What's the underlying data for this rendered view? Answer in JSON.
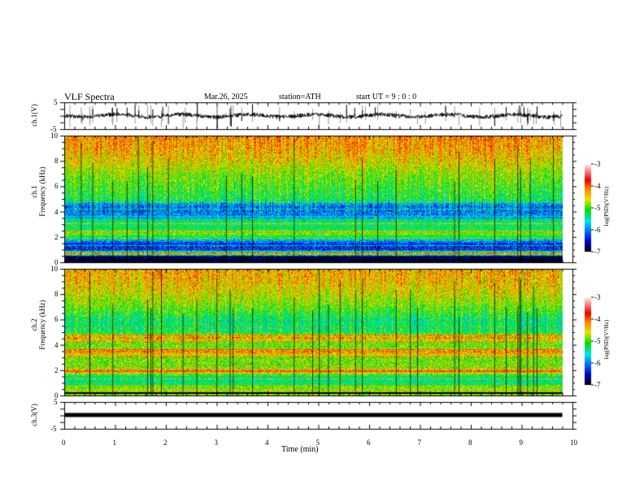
{
  "header": {
    "title": "VLF  Spectra",
    "date": "Mar.26, 2025",
    "station": "station=ATH",
    "start": "start  UT  =   9  : 0  : 0"
  },
  "chart_data": [
    {
      "type": "line",
      "name_label": "ch.1(V)",
      "ylabel": "ch.1(V)",
      "ylim": [
        -5,
        5
      ],
      "yticks": [
        "5",
        "-5"
      ],
      "xlim": [
        0,
        10
      ],
      "data_end_min": 9.8,
      "baseline_v": 0
    },
    {
      "type": "heatmap",
      "ylabel": "ch.1\nFrequency  (kHz)",
      "ylabel_top": "ch.1",
      "ylabel_bottom": "Frequency  (kHz)",
      "ylim": [
        0,
        10
      ],
      "yticks": [
        "0",
        "2",
        "4",
        "6",
        "8",
        "10"
      ],
      "xlim": [
        0,
        10
      ],
      "colorbar": {
        "label": "log(PSD)(V²/Hz)",
        "range": [
          -7,
          -3
        ],
        "ticks": [
          "-3",
          "-4",
          "-5",
          "-6",
          "-7"
        ]
      },
      "profile_khz": [
        0,
        0.5,
        0.7,
        1,
        1.5,
        2,
        2.3,
        2.7,
        3.2,
        3.6,
        4,
        4.5,
        5,
        6,
        7,
        8,
        9,
        10
      ],
      "profile_log_psd": [
        -6.9,
        -6.8,
        -4.2,
        -6.3,
        -6.3,
        -5.3,
        -4.8,
        -5.3,
        -5.2,
        -5.9,
        -6.0,
        -6.0,
        -5.2,
        -5.0,
        -4.8,
        -4.5,
        -4.3,
        -4.2
      ]
    },
    {
      "type": "heatmap",
      "ylabel_top": "ch.2",
      "ylabel_bottom": "Frequency  (kHz)",
      "ylim": [
        0,
        10
      ],
      "yticks": [
        "0",
        "2",
        "4",
        "6",
        "8",
        "10"
      ],
      "xlim": [
        0,
        10
      ],
      "colorbar": {
        "label": "log(PSD)(V²/Hz)",
        "range": [
          -7,
          -3
        ],
        "ticks": [
          "-3",
          "-4",
          "-5",
          "-6",
          "-7"
        ]
      },
      "profile_khz": [
        0,
        0.5,
        1,
        1.5,
        2,
        2.2,
        3,
        3.5,
        3.8,
        4.2,
        4.6,
        5,
        6,
        7,
        8,
        9,
        10
      ],
      "profile_log_psd": [
        -4.8,
        -4.7,
        -5.3,
        -5.4,
        -4.0,
        -4.9,
        -4.9,
        -4.1,
        -4.9,
        -4.9,
        -4.2,
        -5.2,
        -5.3,
        -4.9,
        -4.6,
        -4.4,
        -4.3
      ]
    },
    {
      "type": "line",
      "ylabel": "ch.3(V)",
      "ylim": [
        -5,
        5
      ],
      "yticks": [
        "5",
        "-5"
      ],
      "xlim": [
        0,
        10
      ],
      "data_end_min": 9.8,
      "baseline_v": 0
    },
    {
      "xlabel": "Time  (min)",
      "xticks": [
        "0",
        "1",
        "2",
        "3",
        "4",
        "5",
        "6",
        "7",
        "8",
        "9",
        "10"
      ]
    }
  ]
}
